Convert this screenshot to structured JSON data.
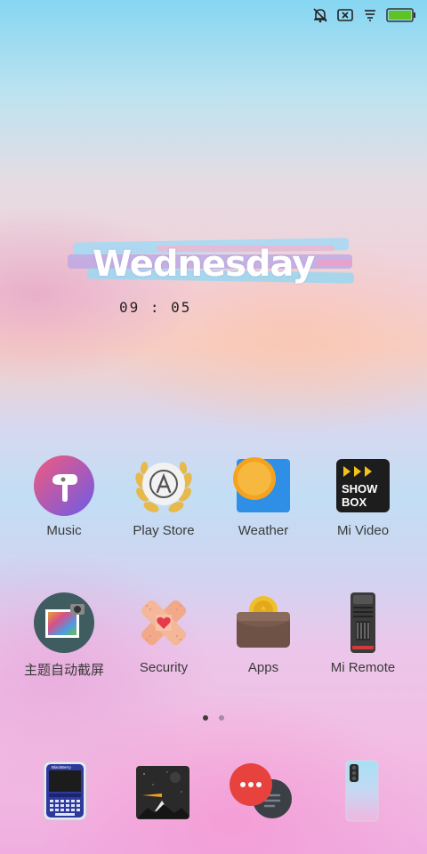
{
  "status_bar": {
    "icons": [
      "alarm-off-icon",
      "sim-error-icon",
      "signal-icon",
      "battery-icon"
    ],
    "battery_color": "#5fc326"
  },
  "clock_widget": {
    "day": "Wednesday",
    "time": "09 : 05"
  },
  "apps_row1": [
    {
      "label": "Music",
      "icon": "music-icon"
    },
    {
      "label": "Play Store",
      "icon": "play-store-icon"
    },
    {
      "label": "Weather",
      "icon": "weather-icon"
    },
    {
      "label": "Mi Video",
      "icon": "mi-video-icon",
      "icon_text": "SHOW\nBOX"
    }
  ],
  "apps_row2": [
    {
      "label": "主题自动截屏",
      "icon": "theme-screenshot-icon"
    },
    {
      "label": "Security",
      "icon": "security-icon"
    },
    {
      "label": "Apps",
      "icon": "apps-wallet-icon"
    },
    {
      "label": "Mi Remote",
      "icon": "mi-remote-icon"
    }
  ],
  "page_indicator": {
    "count": 2,
    "active": 1
  },
  "dock": [
    {
      "icon": "blackberry-phone-icon",
      "brand": "BlackBerry"
    },
    {
      "icon": "space-launcher-icon"
    },
    {
      "icon": "messaging-icon"
    },
    {
      "icon": "huawei-phone-icon"
    }
  ]
}
